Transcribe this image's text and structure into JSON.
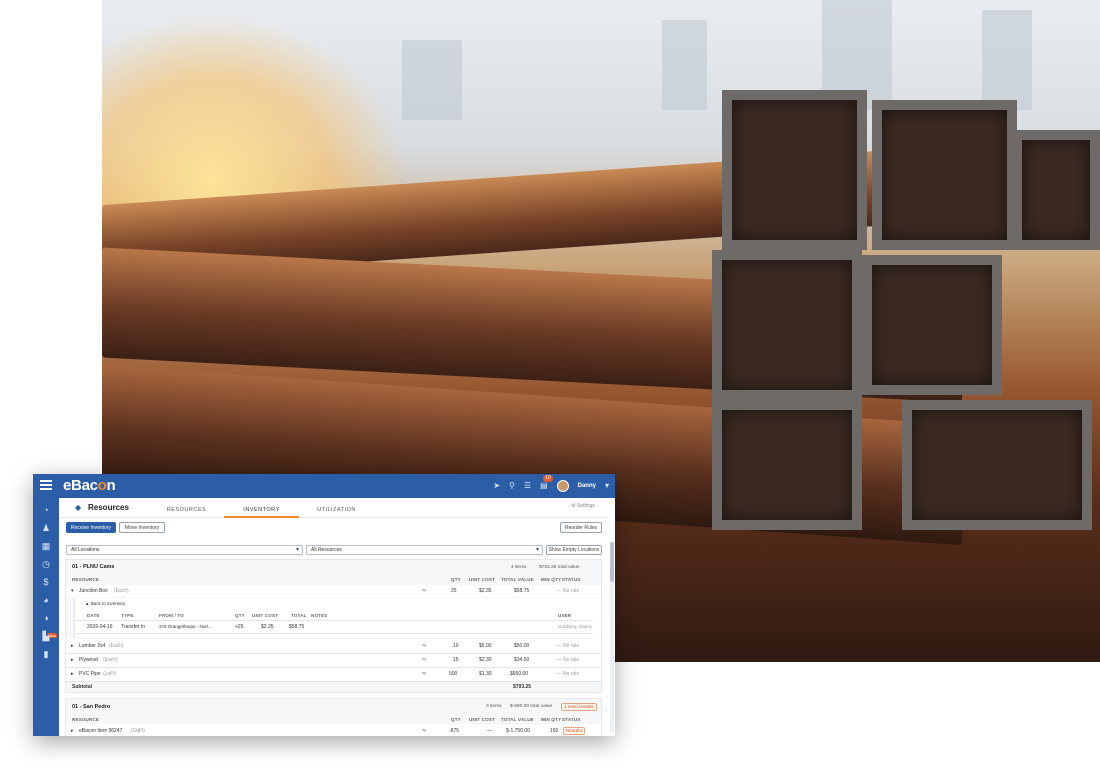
{
  "brand": {
    "logo_text_a": "eBac",
    "logo_text_o": "o",
    "logo_text_b": "n",
    "primary": "#2b5ea7",
    "accent": "#f08a2e"
  },
  "topbar": {
    "notification_count": "10",
    "user": "Danny"
  },
  "sidebar": {
    "new_badge": "New",
    "icons": [
      "dashboard-icon",
      "people-icon",
      "calendar-icon",
      "clock-icon",
      "dollar-icon",
      "pie-chart-icon",
      "resources-icon",
      "warehouse-icon",
      "reports-icon"
    ]
  },
  "page": {
    "title": "Resources",
    "tabs": [
      "RESOURCES",
      "INVENTORY",
      "UTILIZATION"
    ],
    "active_tab": "INVENTORY",
    "settings_label": "Settings"
  },
  "actions": {
    "receive": "Receive Inventory",
    "move": "Move Inventory",
    "reorder_rules": "Reorder Rules"
  },
  "filters": {
    "locations": "All Locations",
    "resources": "All Resources",
    "show_empty": "Show Empty Locations"
  },
  "columns": {
    "resource": "RESOURCE",
    "qty": "QTY",
    "unit_cost": "UNIT COST",
    "total_value": "TOTAL VALUE",
    "min_qty": "MIN QTY",
    "status": "STATUS"
  },
  "group1": {
    "name": "01 - PLNU Cams",
    "items_count": "4 items",
    "total_value_text": "$793.25 total value",
    "rows": [
      {
        "name": "Junction Box",
        "unit": "(Each)",
        "qty": "25",
        "unit_cost": "$2.35",
        "total": "$58.75",
        "min": "—",
        "status": "No rule"
      },
      {
        "name": "Lumber 2x4",
        "unit": "(Each)",
        "qty": "10",
        "unit_cost": "$5.00",
        "total": "$50.00",
        "min": "—",
        "status": "No rule"
      },
      {
        "name": "Plywood",
        "unit": "(Each)",
        "qty": "15",
        "unit_cost": "$2.30",
        "total": "$34.50",
        "min": "—",
        "status": "No rule"
      },
      {
        "name": "PVC Pipe",
        "unit": "(LnFt)",
        "qty": "500",
        "unit_cost": "$1.30",
        "total": "$650.00",
        "min": "—",
        "status": "No rule"
      }
    ],
    "subtotal_label": "Subtotal",
    "subtotal": "$793.25",
    "history": {
      "back": "▲ Back to inventory",
      "cols": {
        "date": "DATE",
        "type": "TYPE",
        "from_to": "FROM / TO",
        "qty": "QTY",
        "unit_cost": "UNIT COST",
        "total": "TOTAL",
        "notes": "NOTES",
        "user": "USER"
      },
      "row": {
        "date": "2026-04-16",
        "type": "Transfer In",
        "from_to": "376 Orangethorpe - Nort...",
        "qty": "+25",
        "unit_cost": "$2.35",
        "total": "$58.75",
        "user": "Goldberg, Danny"
      }
    }
  },
  "group2": {
    "name": "01 - San Pedro",
    "items_count": "3 items",
    "total_value_text": "$-500.00 total value",
    "reorder_text": "1 need reorder",
    "rows": [
      {
        "name": "eBacon Item 96247",
        "unit": "(SqFt)",
        "qty": "-875",
        "unit_cost": "—",
        "total": "$-1,750.00",
        "min": "150",
        "status": "Reorder"
      }
    ]
  }
}
